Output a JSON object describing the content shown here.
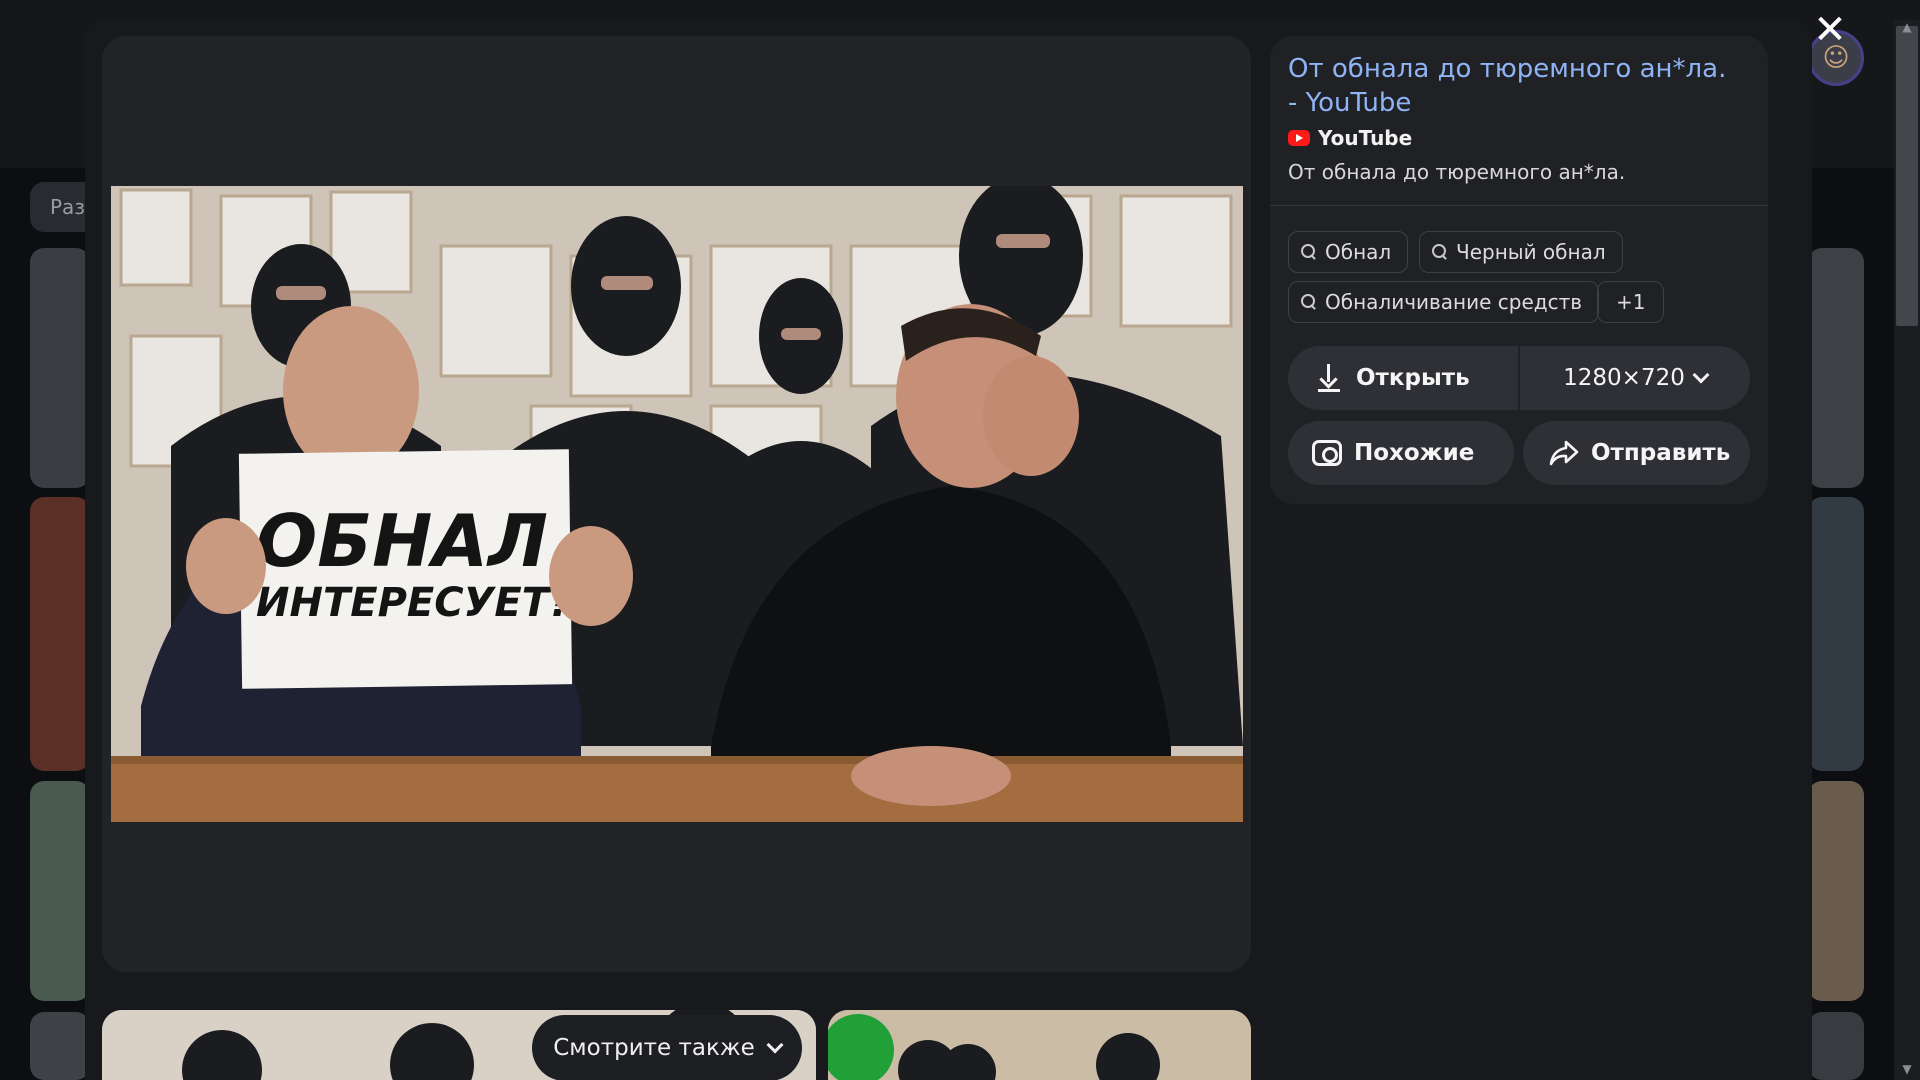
{
  "background": {
    "filter_chip_label": "Раз"
  },
  "modal": {
    "close_label": "✕",
    "image": {
      "sign_line1": "ОБНАЛ",
      "sign_line2": "ИНТЕРЕСУЕТ?"
    },
    "info": {
      "title": "От обнала до тюремного ан*ла. - YouTube",
      "source_name": "YouTube",
      "description": "От обнала до тюремного ан*ла."
    },
    "tags": [
      {
        "label": "Обнал"
      },
      {
        "label": "Черный обнал"
      },
      {
        "label": "Обналичивание средств"
      },
      {
        "label": "+1"
      }
    ],
    "actions": {
      "open_label": "Открыть",
      "size_label": "1280×720",
      "similar_label": "Похожие",
      "send_label": "Отправить"
    },
    "see_also_label": "Смотрите также"
  },
  "colors": {
    "title_link": "#8fb3f4",
    "youtube_red": "#ff1a1a",
    "button_bg": "#2f3035",
    "panel_bg": "#202125"
  }
}
